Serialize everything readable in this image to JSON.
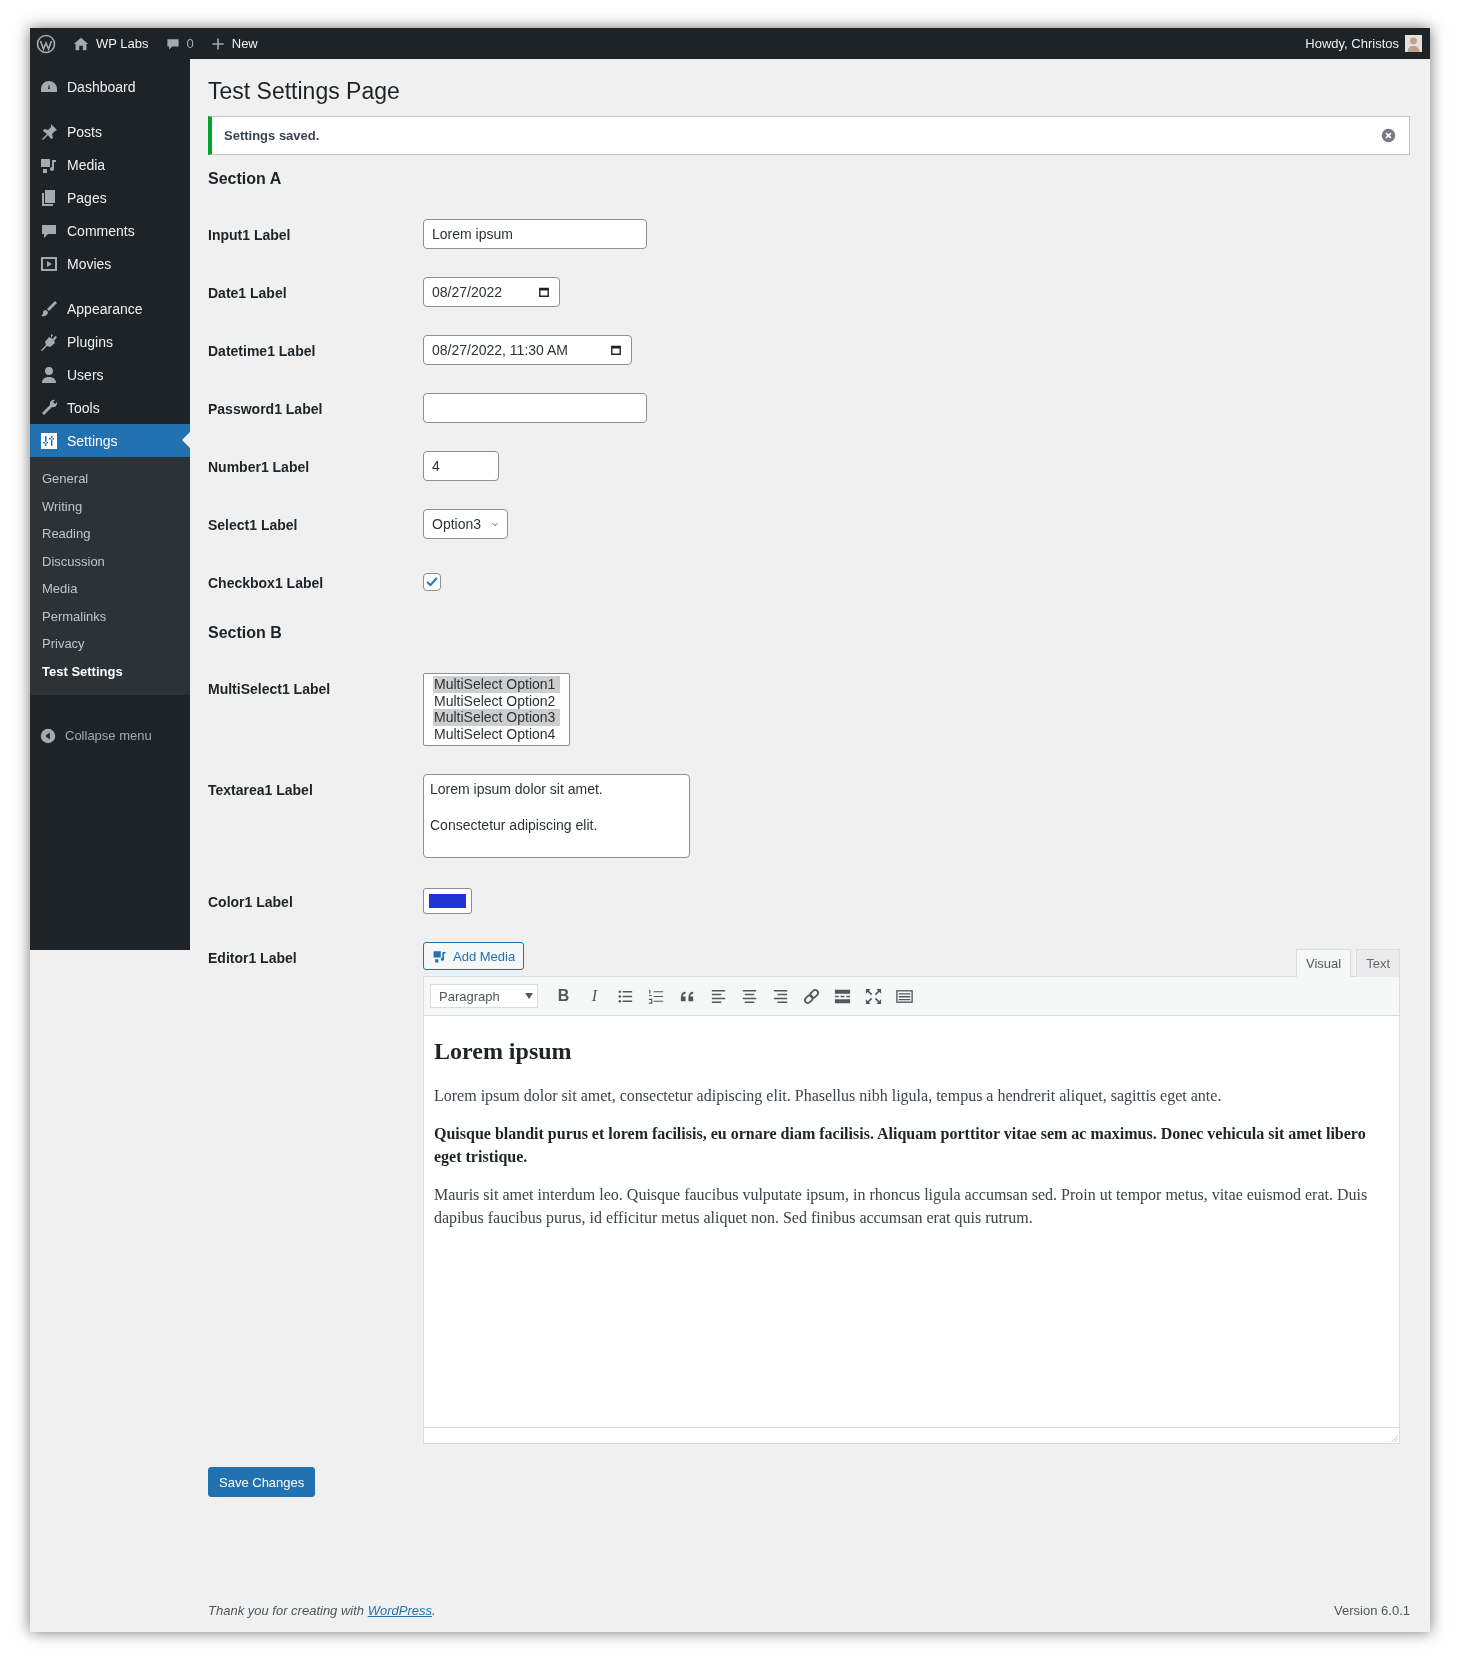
{
  "admin_bar": {
    "site_name": "WP Labs",
    "comment_count": "0",
    "new_label": "New",
    "greeting": "Howdy, Christos"
  },
  "sidebar": {
    "groups": [
      {
        "items": [
          {
            "kind": "dashboard",
            "label": "Dashboard",
            "selected": false
          }
        ]
      },
      {
        "items": [
          {
            "kind": "posts",
            "label": "Posts",
            "selected": false
          },
          {
            "kind": "media",
            "label": "Media",
            "selected": false
          },
          {
            "kind": "pages",
            "label": "Pages",
            "selected": false
          },
          {
            "kind": "comments",
            "label": "Comments",
            "selected": false
          },
          {
            "kind": "movies",
            "label": "Movies",
            "selected": false
          }
        ]
      },
      {
        "items": [
          {
            "kind": "appearance",
            "label": "Appearance",
            "selected": false
          },
          {
            "kind": "plugins",
            "label": "Plugins",
            "selected": false
          },
          {
            "kind": "users",
            "label": "Users",
            "selected": false
          },
          {
            "kind": "tools",
            "label": "Tools",
            "selected": false
          },
          {
            "kind": "settings",
            "label": "Settings",
            "selected": true,
            "children": [
              {
                "label": "General",
                "selected": false
              },
              {
                "label": "Writing",
                "selected": false
              },
              {
                "label": "Reading",
                "selected": false
              },
              {
                "label": "Discussion",
                "selected": false
              },
              {
                "label": "Media",
                "selected": false
              },
              {
                "label": "Permalinks",
                "selected": false
              },
              {
                "label": "Privacy",
                "selected": false
              },
              {
                "label": "Test Settings",
                "selected": true
              }
            ]
          }
        ]
      }
    ],
    "collapse_label": "Collapse menu"
  },
  "page": {
    "title": "Test Settings Page",
    "notice": "Settings saved.",
    "sections": [
      {
        "title": "Section A",
        "fields": [
          {
            "kind": "text",
            "label": "Input1 Label",
            "value": "Lorem ipsum"
          },
          {
            "kind": "date",
            "label": "Date1 Label",
            "value": "08/27/2022"
          },
          {
            "kind": "datetime",
            "label": "Datetime1 Label",
            "value": "08/27/2022, 11:30 AM"
          },
          {
            "kind": "password",
            "label": "Password1 Label"
          },
          {
            "kind": "number",
            "label": "Number1 Label",
            "value": "4"
          },
          {
            "kind": "select",
            "label": "Select1 Label",
            "value": "Option3"
          },
          {
            "kind": "checkbox",
            "label": "Checkbox1 Label",
            "checked": true
          }
        ]
      },
      {
        "title": "Section B",
        "fields": [
          {
            "kind": "multiselect",
            "label": "MultiSelect1 Label",
            "options": [
              {
                "label": "MultiSelect Option1",
                "selected": true
              },
              {
                "label": "MultiSelect Option2",
                "selected": false
              },
              {
                "label": "MultiSelect Option3",
                "selected": true
              },
              {
                "label": "MultiSelect Option4",
                "selected": false
              }
            ]
          },
          {
            "kind": "textarea",
            "label": "Textarea1 Label",
            "paragraphs": [
              "Lorem ipsum dolor sit amet.",
              "Consectetur adipiscing elit."
            ]
          },
          {
            "kind": "color",
            "label": "Color1 Label",
            "color": "#1c35d3"
          },
          {
            "kind": "editor",
            "label": "Editor1 Label",
            "add_media_label": "Add Media",
            "tabs": [
              {
                "label": "Visual",
                "selected": true
              },
              {
                "label": "Text",
                "selected": false
              }
            ],
            "format": "Paragraph",
            "toolbar": [
              {
                "kind": "bold",
                "text": "B"
              },
              {
                "kind": "italic",
                "text": "I"
              },
              {
                "kind": "bullets"
              },
              {
                "kind": "numbers"
              },
              {
                "kind": "quote"
              },
              {
                "kind": "alignleft"
              },
              {
                "kind": "aligncenter"
              },
              {
                "kind": "alignright"
              },
              {
                "kind": "link"
              },
              {
                "kind": "more"
              },
              {
                "kind": "fullscreen"
              },
              {
                "kind": "toolbar"
              }
            ],
            "content": [
              {
                "kind": "heading",
                "text": "Lorem ipsum"
              },
              {
                "kind": "paragraph",
                "text": "Lorem ipsum dolor sit amet, consectetur adipiscing elit. Phasellus nibh ligula, tempus a hendrerit aliquet, sagittis eget ante."
              },
              {
                "kind": "strong",
                "text": "Quisque blandit purus et lorem facilisis, eu ornare diam facilisis. Aliquam porttitor vitae sem ac maximus. Donec vehicula sit amet libero eget tristique."
              },
              {
                "kind": "paragraph",
                "text": "Mauris sit amet interdum leo. Quisque faucibus vulputate ipsum, in rhoncus ligula accumsan sed. Proin ut tempor metus, vitae euismod erat. Duis dapibus faucibus purus, id efficitur metus aliquet non. Sed finibus accumsan erat quis rutrum."
              }
            ]
          }
        ]
      }
    ],
    "save_label": "Save Changes"
  },
  "footer": {
    "text_before": "Thank you for creating with",
    "link": "WordPress",
    "text_after": ".",
    "version": "Version 6.0.1"
  }
}
